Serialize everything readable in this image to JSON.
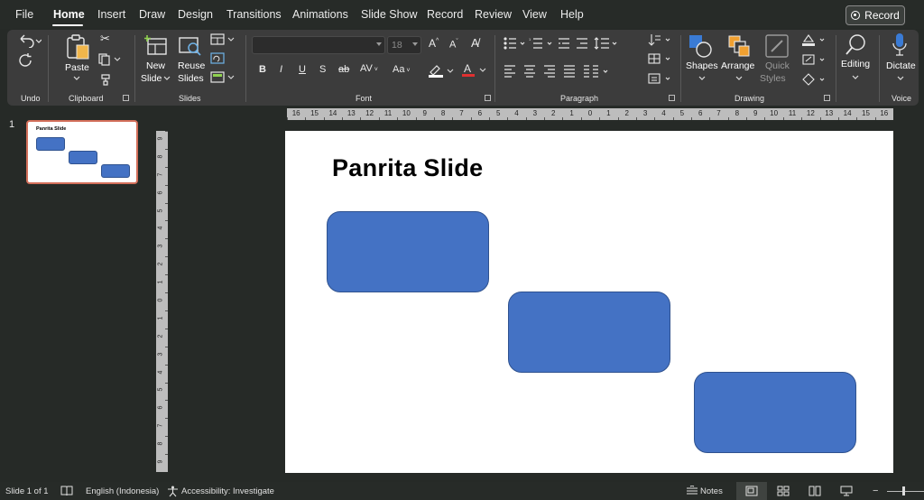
{
  "menubar": {
    "tabs": [
      "File",
      "Home",
      "Insert",
      "Draw",
      "Design",
      "Transitions",
      "Animations",
      "Slide Show",
      "Record",
      "Review",
      "View",
      "Help"
    ],
    "active_tab": "Home",
    "record_button": "Record"
  },
  "ribbon": {
    "groups": {
      "undo": "Undo",
      "clipboard": "Clipboard",
      "slides": "Slides",
      "font": "Font",
      "paragraph": "Paragraph",
      "drawing": "Drawing",
      "voice": "Voice"
    },
    "paste": "Paste",
    "new_slide": [
      "New",
      "Slide"
    ],
    "reuse_slides": [
      "Reuse",
      "Slides"
    ],
    "font_name": "",
    "font_size": "18",
    "shapes": "Shapes",
    "arrange": "Arrange",
    "quick_styles": [
      "Quick",
      "Styles"
    ],
    "editing": "Editing",
    "dictate": "Dictate"
  },
  "thumbnails": {
    "slide_number": "1",
    "title": "Panrita Slide"
  },
  "ruler": {
    "horizontal": [
      "16",
      "15",
      "14",
      "13",
      "12",
      "11",
      "10",
      "9",
      "8",
      "7",
      "6",
      "5",
      "4",
      "3",
      "2",
      "1",
      "0",
      "1",
      "2",
      "3",
      "4",
      "5",
      "6",
      "7",
      "8",
      "9",
      "10",
      "11",
      "12",
      "13",
      "14",
      "15",
      "16"
    ],
    "vertical": [
      "9",
      "8",
      "7",
      "6",
      "5",
      "4",
      "3",
      "2",
      "1",
      "0",
      "1",
      "2",
      "3",
      "4",
      "5",
      "6",
      "7",
      "8",
      "9"
    ]
  },
  "slide": {
    "title": "Panrita Slide",
    "shape_fill": "#4472c4",
    "shape_border": "#2f528f"
  },
  "statusbar": {
    "slide_info": "Slide 1 of 1",
    "language": "English (Indonesia)",
    "accessibility": "Accessibility: Investigate",
    "notes": "Notes"
  },
  "colors": {
    "app_background": "#262a27",
    "ribbon": "#3c3c3c",
    "thumbnail_border": "#d36f5a"
  }
}
